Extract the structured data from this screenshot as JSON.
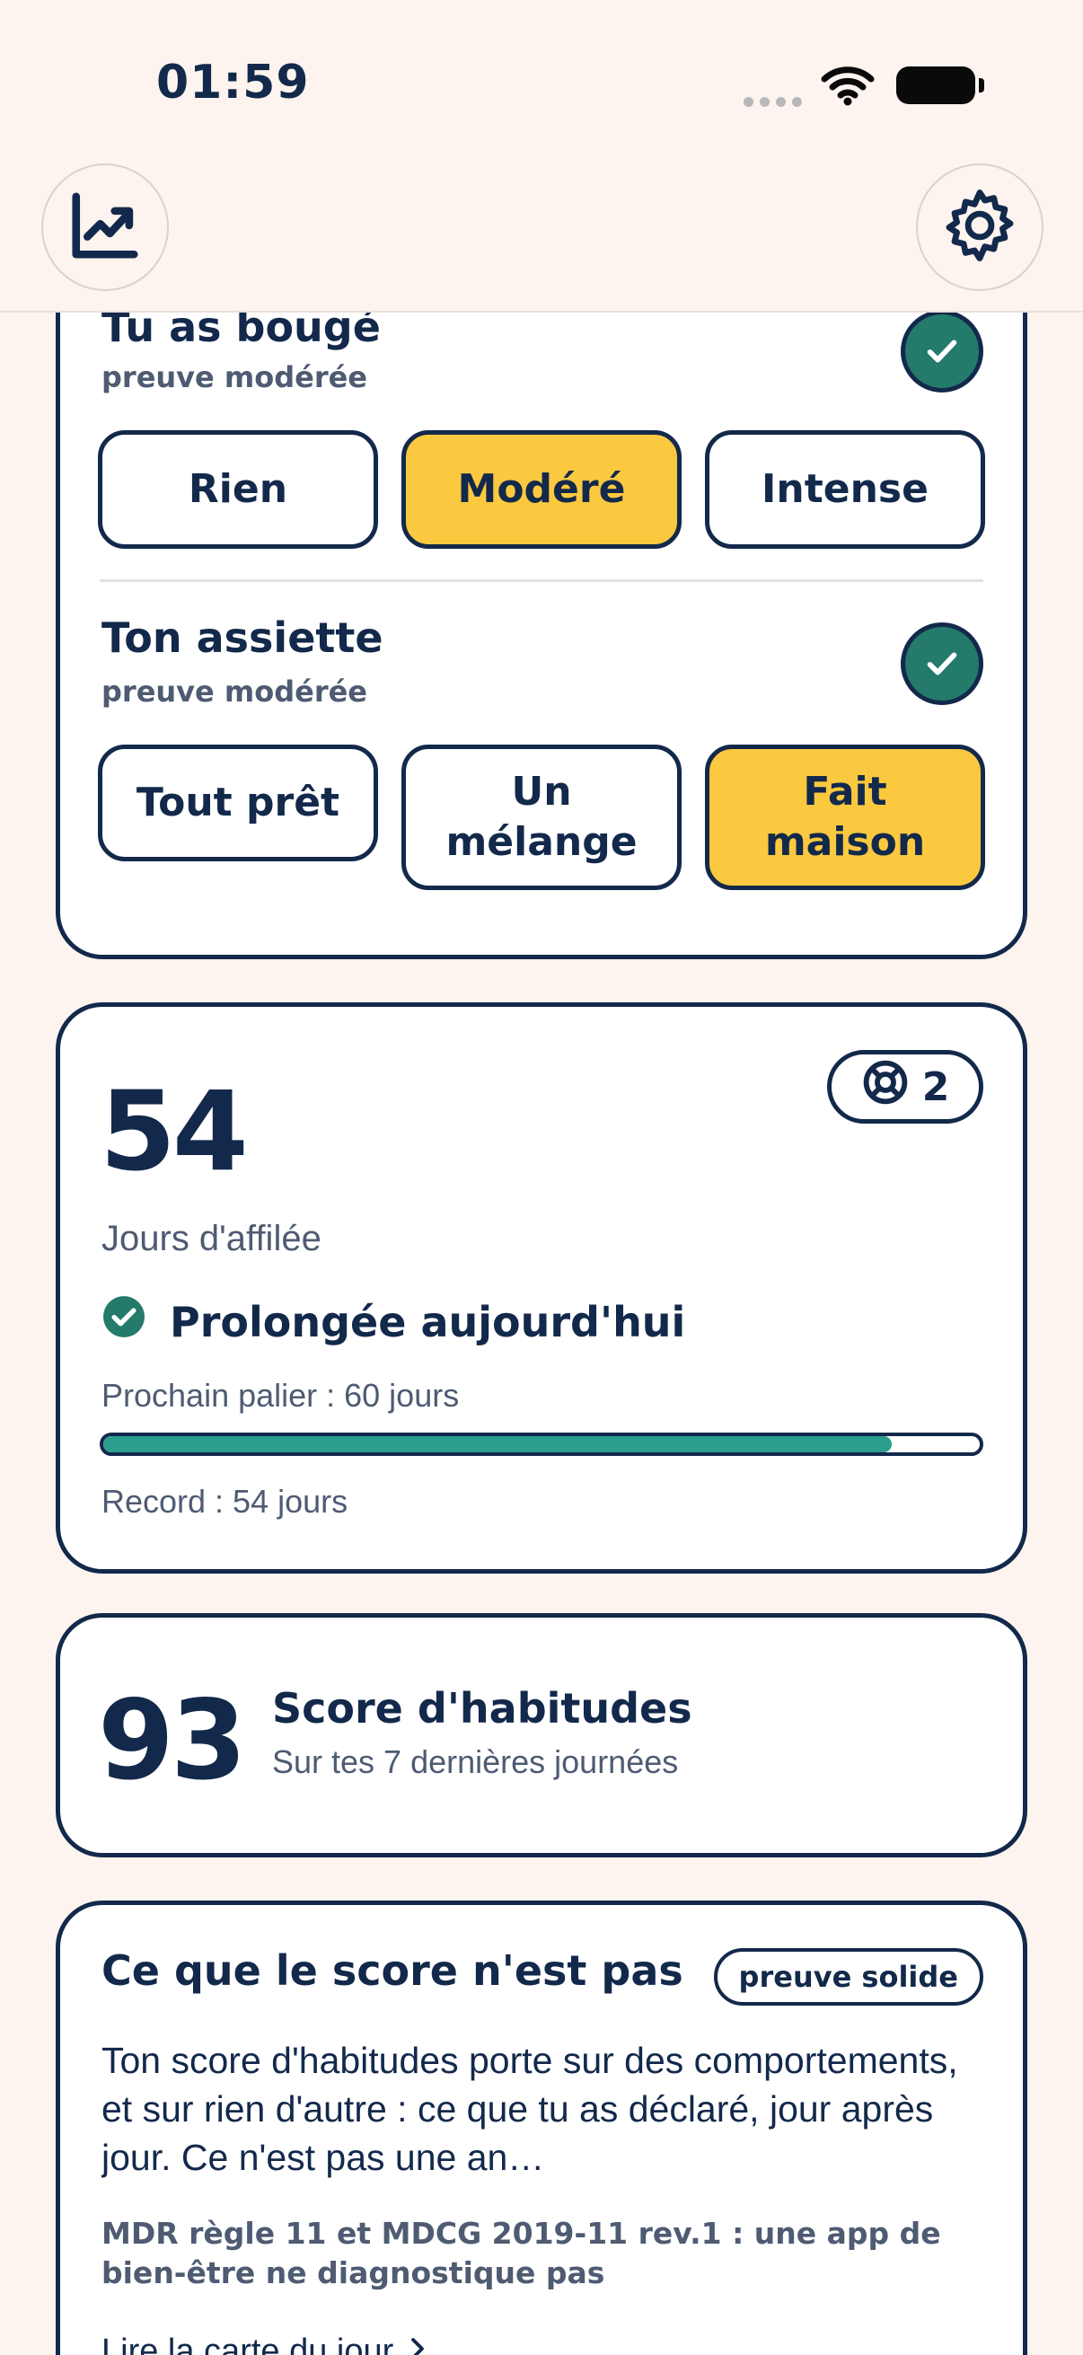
{
  "status_bar": {
    "time": "01:59"
  },
  "header": {
    "left_icon": "chart-trend-icon",
    "right_icon": "gear-icon"
  },
  "habits": [
    {
      "title": "Tu as bougé",
      "proof": "preuve modérée",
      "checked": true,
      "options": [
        "Rien",
        "Modéré",
        "Intense"
      ],
      "selected": "Modéré"
    },
    {
      "title": "Ton assiette",
      "proof": "preuve modérée",
      "checked": true,
      "options": [
        "Tout prêt",
        "Un mélange",
        "Fait maison"
      ],
      "selected": "Fait maison"
    }
  ],
  "streak": {
    "days": "54",
    "rescues": "2",
    "label": "Jours d'affilée",
    "extended": "Prolongée aujourd'hui",
    "next_tier": "Prochain palier : 60 jours",
    "progress": 0.9,
    "record": "Record : 54 jours"
  },
  "score": {
    "value": "93",
    "title": "Score d'habitudes",
    "subtitle": "Sur tes 7 dernières journées"
  },
  "info": {
    "title": "Ce que le score n'est pas",
    "badge": "preuve solide",
    "body": "Ton score d'habitudes porte sur des comportements, et sur rien d'autre : ce que tu as déclaré, jour après jour. Ce n'est pas une an…",
    "reference": "MDR règle 11 et MDCG 2019-11 rev.1 : une app de bien-être ne diagnostique pas",
    "link": "Lire la carte du jour"
  },
  "colors": {
    "background": "#FDF3EF",
    "navy": "#13294B",
    "selected": "#FBC93F",
    "check": "#247A6B",
    "progress": "#2A9D8C"
  }
}
